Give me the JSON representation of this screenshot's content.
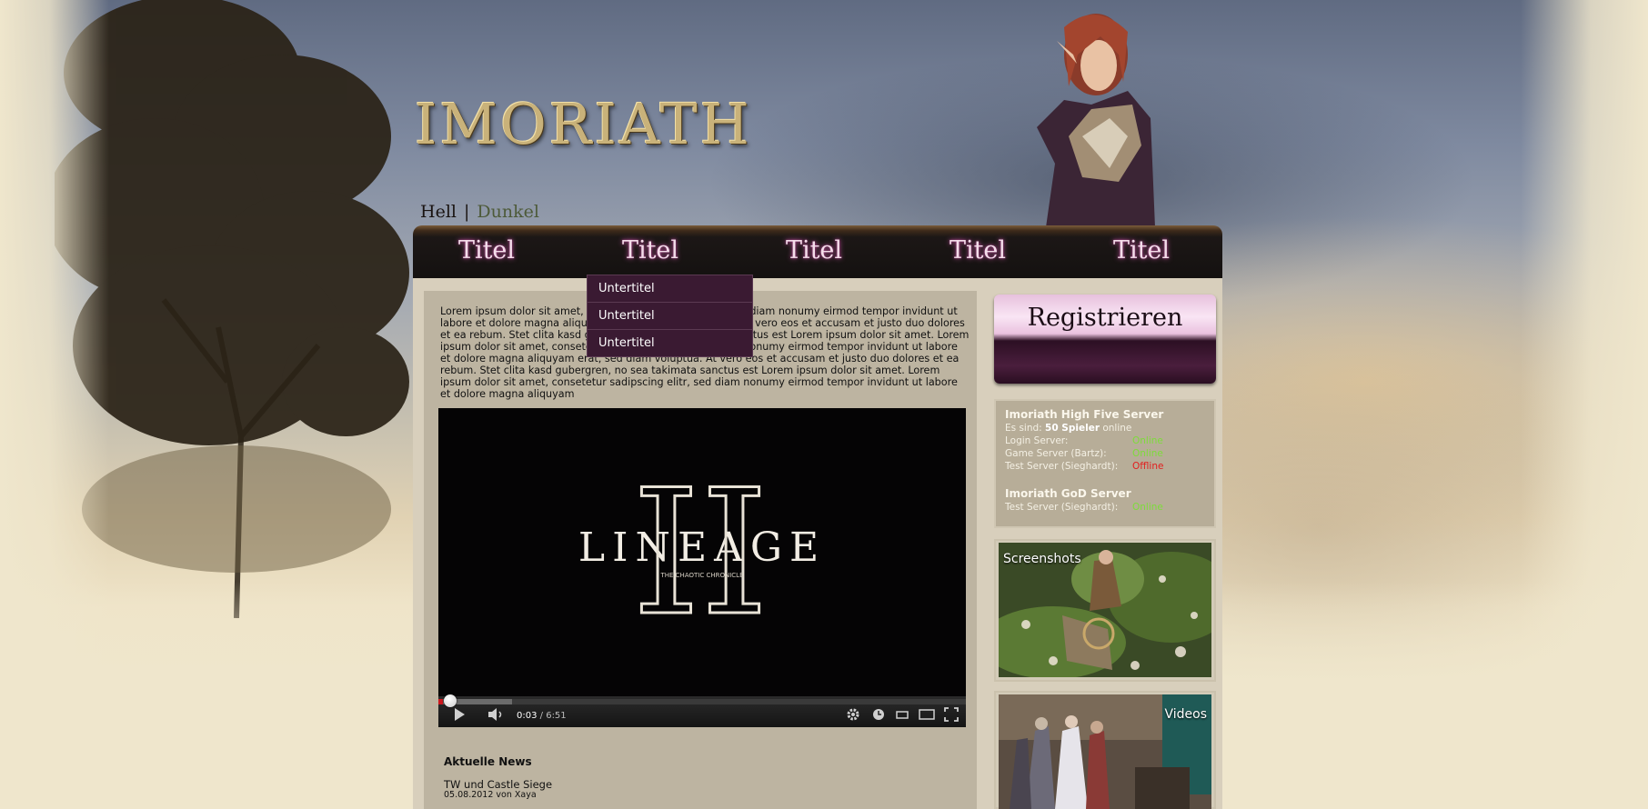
{
  "logo": "IMORIATH",
  "theme": {
    "light": "Hell",
    "separator": "|",
    "dark": "Dunkel"
  },
  "nav": {
    "items": [
      "Titel",
      "Titel",
      "Titel",
      "Titel",
      "Titel"
    ]
  },
  "dropdown": {
    "items": [
      "Untertitel",
      "Untertitel",
      "Untertitel"
    ]
  },
  "intro_text": "Lorem ipsum dolor sit amet, consetetur sadipscing elitr, sed diam nonumy eirmod tempor invidunt ut labore et dolore magna aliquyam erat, sed diam voluptua. At vero eos et accusam et justo duo dolores et ea rebum. Stet clita kasd gubergren, no sea takimata sanctus est Lorem ipsum dolor sit amet. Lorem ipsum dolor sit amet, consetetur sadipscing elitr, sed diam nonumy eirmod tempor invidunt ut labore et dolore magna aliquyam erat, sed diam voluptua. At vero eos et accusam et justo duo dolores et ea rebum. Stet clita kasd gubergren, no sea takimata sanctus est Lorem ipsum dolor sit amet. Lorem ipsum dolor sit amet, consetetur sadipscing elitr, sed diam nonumy eirmod tempor invidunt ut labore et dolore magna aliquyam",
  "video": {
    "logo_text": "LINEAGE",
    "logo_numeral": "II",
    "logo_subtitle": "THE CHAOTIC CHRONICLE",
    "time_current": "0:03",
    "time_sep": " / ",
    "time_total": "6:51",
    "progress_played": 0.008,
    "progress_buffered": 0.14
  },
  "news": {
    "heading": "Aktuelle News",
    "items": [
      {
        "title": "TW und Castle Siege",
        "meta": "05.08.2012 von Xaya"
      }
    ]
  },
  "register": {
    "label": "Registrieren"
  },
  "servers": {
    "high_five": {
      "title": "Imoriath High Five Server",
      "players_prefix": "Es sind:",
      "players_count": "50 Spieler",
      "players_suffix": "online",
      "rows": [
        {
          "label": "Login Server:",
          "value": "Online",
          "state": "online"
        },
        {
          "label": "Game Server (Bartz):",
          "value": "Online",
          "state": "online"
        },
        {
          "label": "Test Server (Sieghardt):",
          "value": "Offline",
          "state": "offline"
        }
      ]
    },
    "god": {
      "title": "Imoriath GoD Server",
      "rows": [
        {
          "label": "Test Server (Sieghardt):",
          "value": "Online",
          "state": "online"
        }
      ]
    }
  },
  "media": {
    "screenshots_label": "Screenshots",
    "videos_label": "Videos"
  },
  "colors": {
    "online": "#7ddc3a",
    "offline": "#e21e1e",
    "nav_glow": "#c95aa5",
    "dropdown_bg": "#3a1a32"
  }
}
